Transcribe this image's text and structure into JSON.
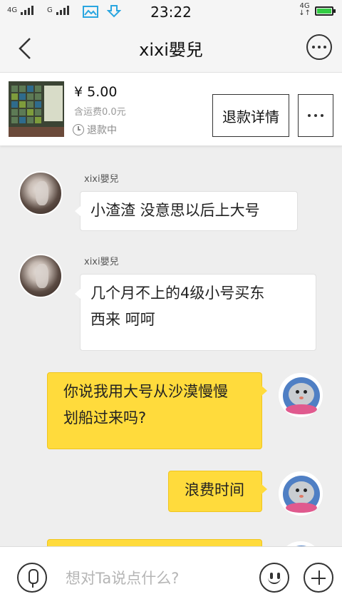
{
  "status_bar": {
    "network_1": "4G",
    "network_2": "G",
    "time": "23:22",
    "network_right": "4G",
    "icons": [
      "signal-icon",
      "signal-icon",
      "gallery-icon",
      "download-icon",
      "battery-icon"
    ],
    "battery_color": "#33cc44"
  },
  "nav": {
    "title": "xixi嬰兒",
    "back_icon": "back-arrow-icon",
    "more_icon": "more-icon"
  },
  "order": {
    "price": "¥ 5.00",
    "shipping": "含运费0.0元",
    "status": "退款中",
    "refund_button": "退款详情",
    "more_icon": "more-icon"
  },
  "messages": [
    {
      "sender": "other",
      "name": "xixi嬰兒",
      "lines": [
        "小渣渣 没意思以后上大号"
      ]
    },
    {
      "sender": "other",
      "name": "xixi嬰兒",
      "lines": [
        "几个月不上的4级小号买东",
        "西来 呵呵"
      ]
    },
    {
      "sender": "me",
      "lines": [
        "你说我用大号从沙漠慢慢",
        "划船过来吗?"
      ]
    },
    {
      "sender": "me",
      "lines": [
        "浪费时间"
      ]
    }
  ],
  "input": {
    "placeholder": "想对Ta说点什么?",
    "mic_icon": "microphone-icon",
    "emoji_icon": "emoji-icon",
    "plus_icon": "plus-icon"
  },
  "colors": {
    "my_bubble": "#ffdb3c",
    "other_bubble": "#ffffff",
    "background": "#eeeeee"
  }
}
